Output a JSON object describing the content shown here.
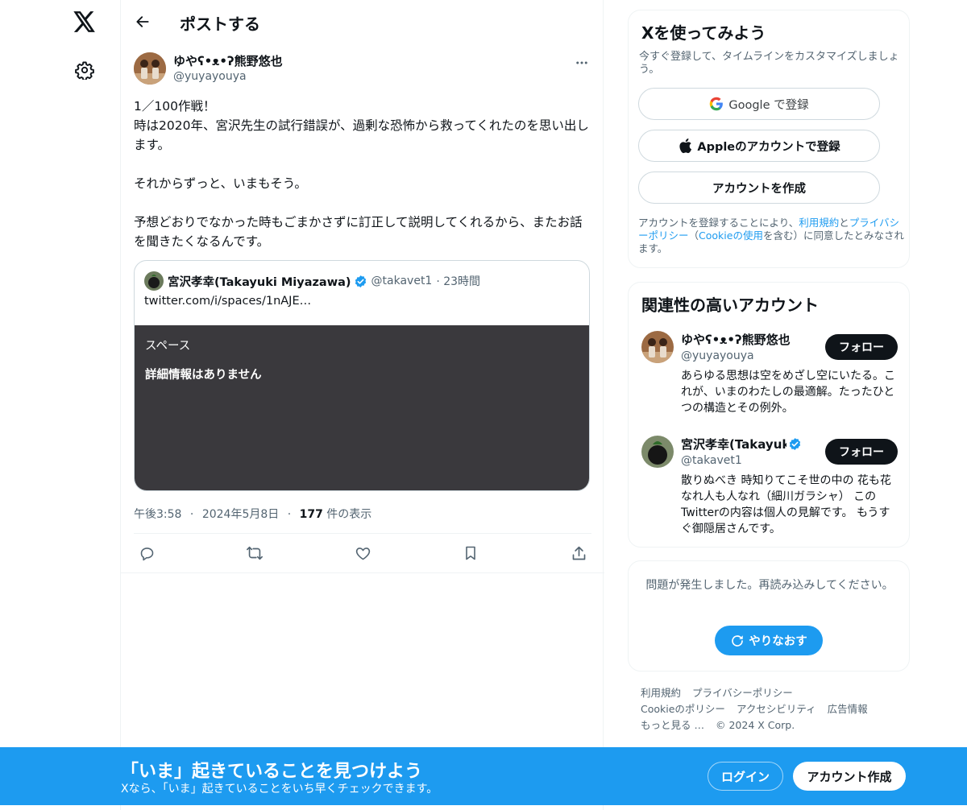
{
  "header": {
    "title": "ポストする"
  },
  "tweet": {
    "author_name": "ゆやʕ•ᴥ•ʔ熊野悠也",
    "author_handle": "@yuyayouya",
    "text": "1／100作戦！\n時は2020年、宮沢先生の試行錯誤が、過剰な恐怖から救ってくれたのを思い出します。\n\nそれからずっと、いまもそう。\n\n予想どおりでなかった時もごまかさずに訂正して説明してくれるから、またお話を聞きたくなるんです。",
    "time": "午後3:58",
    "date": "2024年5月8日",
    "separator": "·",
    "views": "177",
    "views_label": " 件の表示"
  },
  "quote": {
    "name": "宮沢孝幸(Takayuki Miyazawa)",
    "handle": "@takavet1",
    "time": "· 23時間",
    "link": "twitter.com/i/spaces/1nAJE…",
    "space_label": "スペース",
    "space_detail": "詳細情報はありません"
  },
  "signup": {
    "title": "Xを使ってみよう",
    "subtitle": "今すぐ登録して、タイムラインをカスタマイズしましょう。",
    "google_label": "Google で登録",
    "apple_label": "Appleのアカウントで登録",
    "create_label": "アカウントを作成",
    "legal_pre": "アカウントを登録することにより、",
    "legal_terms": "利用規約",
    "legal_and": "と",
    "legal_privacy": "プライバシーポリシー",
    "legal_mid": "（",
    "legal_cookie": "Cookieの使用",
    "legal_post": "を含む）に同意したとみなされます。"
  },
  "relevant": {
    "title": "関連性の高いアカウント",
    "accounts": [
      {
        "name": "ゆやʕ•ᴥ•ʔ熊野悠也",
        "handle": "@yuyayouya",
        "bio": "あらゆる思想は空をめざし空にいたる。これが、いまのわたしの最適解。たったひとつの構造とその例外。",
        "follow": "フォロー"
      },
      {
        "name": "宮沢孝幸(Takayuki M",
        "handle": "@takavet1",
        "bio": "散りぬべき 時知りてこそ世の中の 花も花なれ人も人なれ（細川ガラシャ） このTwitterの内容は個人の見解です。 もうすぐ御隠居さんです。",
        "follow": "フォロー"
      }
    ]
  },
  "error": {
    "message": "問題が発生しました。再読み込みしてください。",
    "retry": "やりなおす"
  },
  "footer": {
    "links": [
      "利用規約",
      "プライバシーポリシー",
      "Cookieのポリシー",
      "アクセシビリティ",
      "広告情報",
      "もっと見る …",
      "© 2024 X Corp."
    ]
  },
  "banner": {
    "title": "「いま」起きていることを見つけよう",
    "subtitle": "Xなら、「いま」起きていることをいち早くチェックできます。",
    "login": "ログイン",
    "signup": "アカウント作成"
  },
  "colors": {
    "accent": "#1d9bf0",
    "text": "#0f1419",
    "muted": "#536471",
    "space_bg": "#3a393d"
  }
}
